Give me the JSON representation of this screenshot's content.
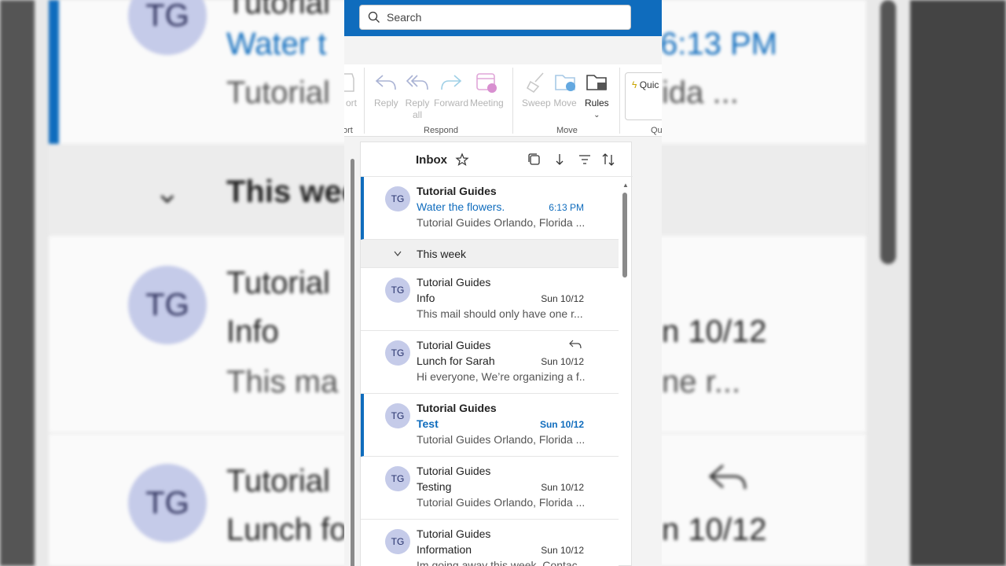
{
  "search": {
    "placeholder": "Search"
  },
  "ribbon": {
    "buttons": [
      {
        "label": "Reply"
      },
      {
        "label": "Reply all"
      },
      {
        "label": "Forward"
      },
      {
        "label": "Meeting"
      },
      {
        "label": "Sweep"
      },
      {
        "label": "Move"
      },
      {
        "label": "Rules"
      }
    ],
    "groups": {
      "report": "ort",
      "report_btn": "ort",
      "respond": "Respond",
      "move": "Move",
      "quick": "Qu"
    },
    "quick_label": "Quic"
  },
  "inbox": {
    "title": "Inbox"
  },
  "section": {
    "label": "This week"
  },
  "mails": [
    {
      "sender": "Tutorial Guides",
      "subject": "Water the flowers.",
      "date": "6:13 PM",
      "preview": "Tutorial Guides Orlando, Florida ..."
    },
    {
      "sender": "Tutorial Guides",
      "subject": "Info",
      "date": "Sun 10/12",
      "preview": "This mail should only have one r..."
    },
    {
      "sender": "Tutorial Guides",
      "subject": "Lunch for Sarah",
      "date": "Sun 10/12",
      "preview": "Hi everyone, We’re organizing a f..."
    },
    {
      "sender": "Tutorial Guides",
      "subject": "Test",
      "date": "Sun 10/12",
      "preview": "Tutorial Guides Orlando, Florida ..."
    },
    {
      "sender": "Tutorial Guides",
      "subject": "Testing",
      "date": "Sun 10/12",
      "preview": "Tutorial Guides Orlando, Florida ..."
    },
    {
      "sender": "Tutorial Guides",
      "subject": "Information",
      "date": "Sun 10/12",
      "preview": "Im going away this week. Contac..."
    }
  ],
  "avatar_initials": "TG",
  "background": {
    "line1": "Tutorial",
    "line2": "Water t",
    "time": "6:13 PM",
    "line3": "Tutorial",
    "line3b": "ida ...",
    "week": "This wee",
    "row2a": "Tutorial",
    "row2b": "Info",
    "row2c": "This ma",
    "row2d": "n 10/12",
    "row2e": "ne r...",
    "row3a": "Tutorial",
    "row3b": "Lunch fo",
    "row3d": "n 10/12"
  },
  "colors": {
    "accent": "#0f6cbd",
    "avatar": "#c5cbe9"
  }
}
